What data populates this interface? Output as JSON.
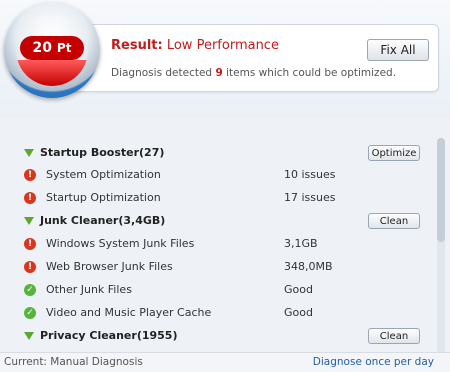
{
  "result": {
    "score_value": "20",
    "score_unit": "Pt",
    "title_label": "Result:",
    "title_value": "Low Performance",
    "desc_prefix": "Diagnosis detected",
    "desc_count": "9",
    "desc_suffix": "items which could be optimized.",
    "fix_button": "Fix All"
  },
  "sections": [
    {
      "title": "Startup Booster(27)",
      "button": "Optimize",
      "items": [
        {
          "label": "System Optimization",
          "value": "10 issues",
          "status": "warning"
        },
        {
          "label": "Startup Optimization",
          "value": "17 issues",
          "status": "warning"
        }
      ]
    },
    {
      "title": "Junk Cleaner(3,4GB)",
      "button": "Clean",
      "items": [
        {
          "label": "Windows System Junk Files",
          "value": "3,1GB",
          "status": "warning"
        },
        {
          "label": "Web Browser Junk Files",
          "value": "348,0MB",
          "status": "warning"
        },
        {
          "label": "Other Junk Files",
          "value": "Good",
          "status": "ok"
        },
        {
          "label": "Video and Music Player Cache",
          "value": "Good",
          "status": "ok"
        }
      ]
    },
    {
      "title": "Privacy Cleaner(1955)",
      "button": "Clean",
      "items": []
    }
  ],
  "footer": {
    "status": "Current: Manual Diagnosis",
    "link": "Diagnose once per day"
  },
  "icons": {
    "expand": "triangle-down-icon",
    "warning": "exclamation-icon",
    "ok": "checkmark-icon"
  },
  "colors": {
    "accent_red": "#c41b1b",
    "warning": "#d8361f",
    "ok": "#56b43a",
    "expand": "#5aa82e",
    "link": "#1f5fa8"
  }
}
